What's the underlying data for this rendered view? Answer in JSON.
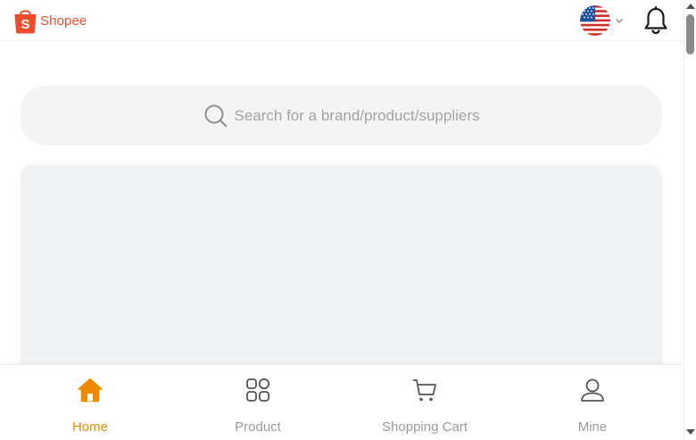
{
  "header": {
    "logo_text": "Shopee",
    "language_flag": "us-flag-icon",
    "notification_icon": "bell-icon"
  },
  "search": {
    "placeholder": "Search for a brand/product/suppliers",
    "icon": "search-icon"
  },
  "bottom_nav": {
    "items": [
      {
        "label": "Home",
        "icon": "home-icon",
        "active": true
      },
      {
        "label": "Product",
        "icon": "grid-icon",
        "active": false
      },
      {
        "label": "Shopping Cart",
        "icon": "cart-icon",
        "active": false
      },
      {
        "label": "Mine",
        "icon": "user-icon",
        "active": false
      }
    ]
  },
  "colors": {
    "brand": "#ee4d2d",
    "active_nav": "#f08a00",
    "inactive_nav": "#9a9a9a",
    "search_bg": "#f4f4f4"
  }
}
